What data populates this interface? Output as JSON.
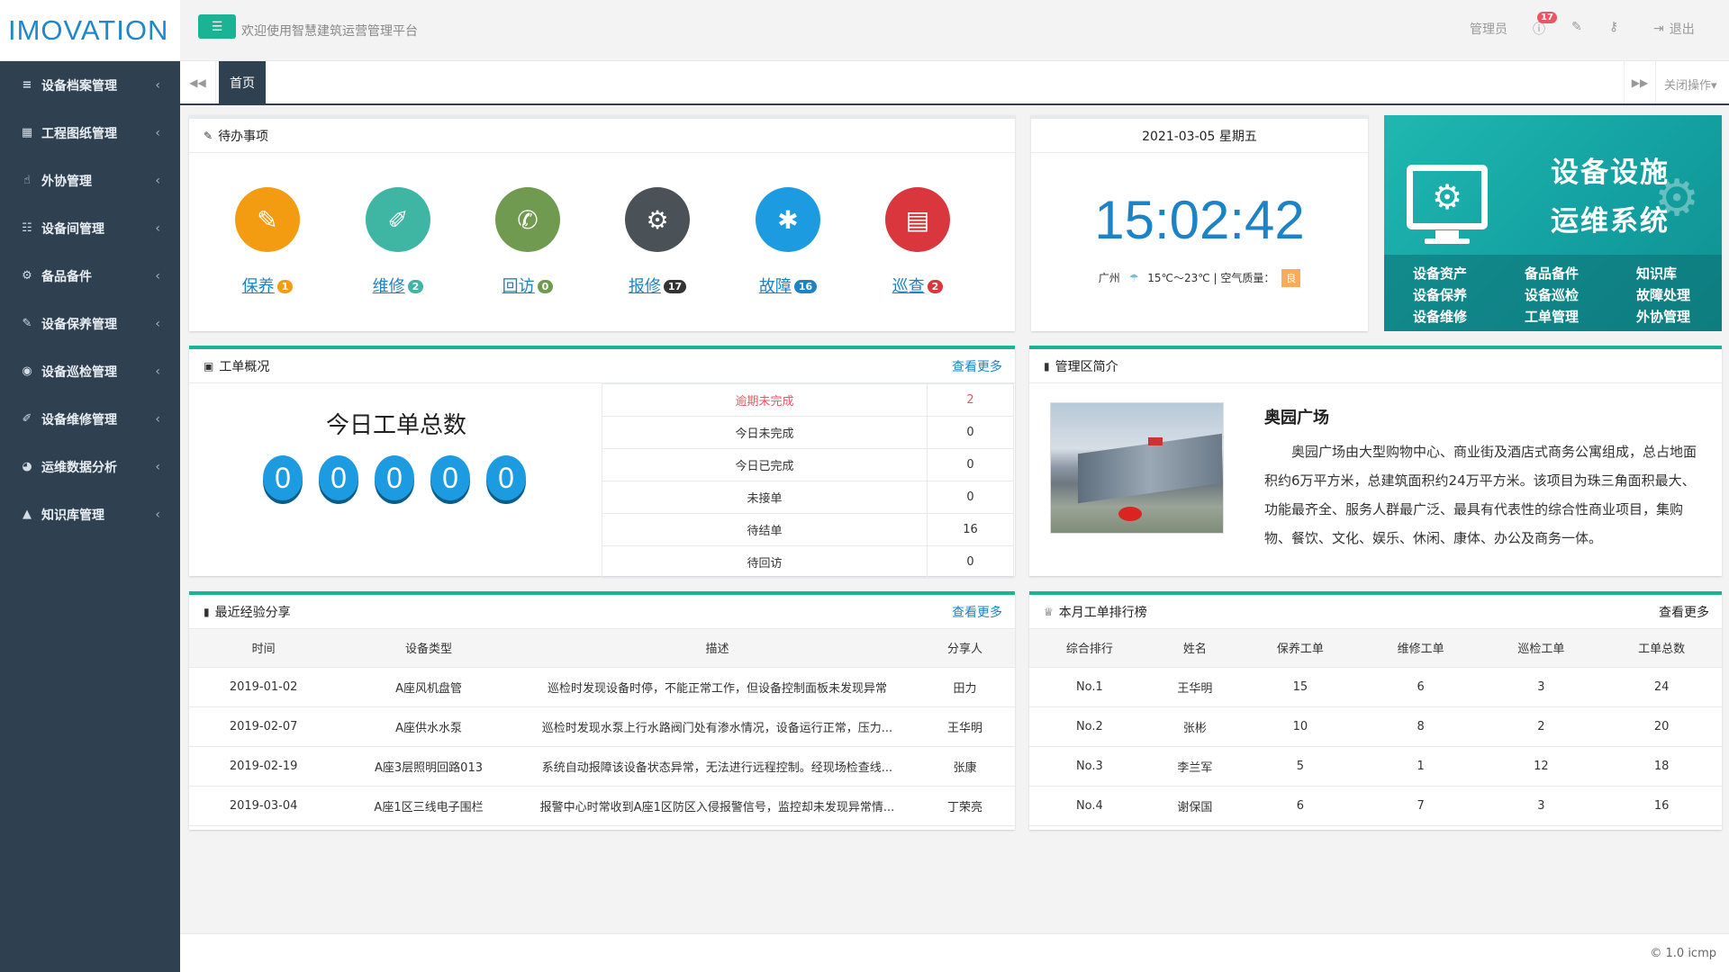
{
  "logo": "IMOVATION",
  "header": {
    "welcome": "欢迎使用智慧建筑运营管理平台",
    "admin": "管理员",
    "notifications": "17",
    "logout": "退出"
  },
  "sidebar": {
    "items": [
      {
        "label": "设备档案管理",
        "icon": "list-icon"
      },
      {
        "label": "工程图纸管理",
        "icon": "blueprint-icon"
      },
      {
        "label": "外协管理",
        "icon": "hand-icon"
      },
      {
        "label": "设备间管理",
        "icon": "grid-icon"
      },
      {
        "label": "备品备件",
        "icon": "cogs-icon"
      },
      {
        "label": "设备保养管理",
        "icon": "wand-icon"
      },
      {
        "label": "设备巡检管理",
        "icon": "circle-dot-icon"
      },
      {
        "label": "设备维修管理",
        "icon": "wrench-icon"
      },
      {
        "label": "运维数据分析",
        "icon": "pie-icon"
      },
      {
        "label": "知识库管理",
        "icon": "graduation-icon"
      }
    ]
  },
  "tabs": {
    "home": "首页",
    "close_ops": "关闭操作"
  },
  "todo": {
    "title": "待办事项",
    "items": [
      {
        "label": "保养",
        "count": "1",
        "color": "#f39c12",
        "badge": "#f39c12",
        "icon": "wand-icon",
        "glyph": "✎"
      },
      {
        "label": "维修",
        "count": "2",
        "color": "#3fb5a3",
        "badge": "#3fb5a3",
        "icon": "wrench-icon",
        "glyph": "✐"
      },
      {
        "label": "回访",
        "count": "0",
        "color": "#6f9a4f",
        "badge": "#6f9a4f",
        "icon": "phone-icon",
        "glyph": "✆"
      },
      {
        "label": "报修",
        "count": "17",
        "color": "#4a5258",
        "badge": "#333333",
        "icon": "cogs-icon",
        "glyph": "⚙"
      },
      {
        "label": "故障",
        "count": "16",
        "color": "#1c9be0",
        "badge": "#1c84c6",
        "icon": "bug-icon",
        "glyph": "✱"
      },
      {
        "label": "巡查",
        "count": "2",
        "color": "#d9363e",
        "badge": "#d9363e",
        "icon": "map-icon",
        "glyph": "▤"
      }
    ]
  },
  "clock": {
    "date": "2021-03-05 星期五",
    "time": "15:02:42",
    "city": "广州",
    "temp": "15℃～23℃",
    "aq_label": "空气质量：",
    "aq_value": "良"
  },
  "banner": {
    "title1": "设备设施",
    "title2": "运维系统",
    "items": [
      "设备资产",
      "备品备件",
      "知识库",
      "设备保养",
      "设备巡检",
      "故障处理",
      "设备维修",
      "工单管理",
      "外协管理"
    ]
  },
  "work": {
    "title": "工单概况",
    "more": "查看更多",
    "today_title": "今日工单总数",
    "digits": [
      "0",
      "0",
      "0",
      "0",
      "0"
    ],
    "rows": [
      {
        "label": "逾期未完成",
        "value": "2"
      },
      {
        "label": "今日未完成",
        "value": "0"
      },
      {
        "label": "今日已完成",
        "value": "0"
      },
      {
        "label": "未接单",
        "value": "0"
      },
      {
        "label": "待结单",
        "value": "16"
      },
      {
        "label": "待回访",
        "value": "0"
      }
    ]
  },
  "intro": {
    "title": "管理区简介",
    "name": "奥园广场",
    "desc": "奥园广场由大型购物中心、商业街及酒店式商务公寓组成，总占地面积约6万平方米，总建筑面积约24万平方米。该项目为珠三角面积最大、功能最齐全、服务人群最广泛、最具有代表性的综合性商业项目，集购物、餐饮、文化、娱乐、休闲、康体、办公及商务一体。"
  },
  "experience": {
    "title": "最近经验分享",
    "more": "查看更多",
    "headers": [
      "时间",
      "设备类型",
      "描述",
      "分享人"
    ],
    "rows": [
      [
        "2019-01-02",
        "A座风机盘管",
        "巡检时发现设备时停，不能正常工作，但设备控制面板未发现异常",
        "田力"
      ],
      [
        "2019-02-07",
        "A座供水水泵",
        "巡检时发现水泵上行水路阀门处有渗水情况，设备运行正常，压力...",
        "王华明"
      ],
      [
        "2019-02-19",
        "A座3层照明回路013",
        "系统自动报障该设备状态异常，无法进行远程控制。经现场检查线...",
        "张康"
      ],
      [
        "2019-03-04",
        "A座1区三线电子围栏",
        "报警中心时常收到A座1区防区入侵报警信号，监控却未发现异常情...",
        "丁荣亮"
      ]
    ]
  },
  "ranking": {
    "title": "本月工单排行榜",
    "more": "查看更多",
    "headers": [
      "综合排行",
      "姓名",
      "保养工单",
      "维修工单",
      "巡检工单",
      "工单总数"
    ],
    "rows": [
      [
        "No.1",
        "王华明",
        "15",
        "6",
        "3",
        "24"
      ],
      [
        "No.2",
        "张彬",
        "10",
        "8",
        "2",
        "20"
      ],
      [
        "No.3",
        "李兰军",
        "5",
        "1",
        "12",
        "18"
      ],
      [
        "No.4",
        "谢保国",
        "6",
        "7",
        "3",
        "16"
      ]
    ]
  },
  "footer": "© 1.0 icmp",
  "colors": {
    "accent": "#1ab394",
    "link": "#1c84c6",
    "sidebar": "#2f4050",
    "danger": "#ed5565"
  }
}
